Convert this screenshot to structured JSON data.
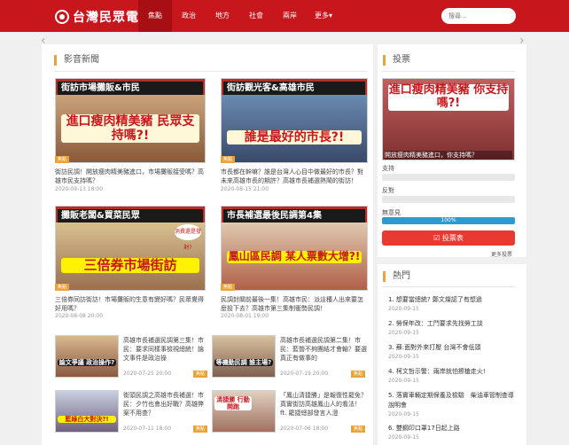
{
  "header": {
    "logo": "台灣民眾電子報",
    "nav": [
      "焦點",
      "政治",
      "地方",
      "社會",
      "兩岸",
      "更多▾"
    ],
    "search_placeholder": "搜尋..."
  },
  "video": {
    "title": "影音新聞",
    "tag": "焦點",
    "cards": [
      {
        "banner": "街訪市場攤販&市民",
        "big": "進口瘦肉精美豬 民眾支持嗎?!",
        "text": "街訪民調！開放瘦肉精美豬進口，市場攤販接受嗎？高雄市民支持嗎？",
        "date": "2020-09-13 18:00"
      },
      {
        "banner": "街訪觀光客&高雄市民",
        "big": "誰是最好的市長?!",
        "text": "市長都在幹嘛？誰是台灣人心目中做最好的市長？對未來高雄市長的期許？高雄市長補選熱鬧的街訪！",
        "date": "2020-08-15 21:00"
      },
      {
        "banner": "攤販老闆&買菜民眾",
        "big": "三倍券市場街訪",
        "sticker": "消費還是發財?",
        "text": "三倍券同訪街訪！市場攤販的生意有變好嗎？民眾覺得好用嗎？",
        "date": "2020-08-08 20:00"
      },
      {
        "banner": "市長補選最後民調第4集",
        "big": "鳳山區民調 某人票數大增?!",
        "text": "民調封關前最後一集！高雄市民：派這種人出來要怎麼投下去？高雄市第三集制衝勢民調！",
        "date": "2020-08-01 19:00"
      }
    ],
    "small_cards": [
      {
        "thumb": "論文爭議 政治操作?",
        "text": "高雄市長補選民調第三集！市民：要求同樣事檢視總統！論文事件是政治操",
        "date": "2020-07-25 20:00"
      },
      {
        "thumb": "等機動民調 誰主場?",
        "text": "高雄市長補選民調第二集！市民：藍營不夠團結才會輸？要選真正有做事的",
        "date": "2020-07-19 20:00"
      },
      {
        "thumb": "藍綠白大對決?!",
        "text": "街頭民調之高雄市長補選！市民：夕竹也會出好戰？高雄弊案不用查？",
        "date": "2020-07-11 18:00"
      },
      {
        "thumb": "清捷勝 行動開跑",
        "text": "「鳳山清捷勝」是報復性罷免？真實街訪高雄鳳山人的看法！ft. 罷捷總部發言人澄",
        "date": "2020-07-06 18:00"
      }
    ]
  },
  "poll": {
    "title": "投票",
    "image_text": "進口瘦肉精美豬 你支持嗎?!",
    "caption": "開放瘦肉精美豬進口，你支持嗎？",
    "options": [
      {
        "label": "支持",
        "percent": 0,
        "text": ""
      },
      {
        "label": "反對",
        "percent": 0,
        "text": ""
      },
      {
        "label": "無意見",
        "percent": 100,
        "text": "100%"
      }
    ],
    "vote_label": "☑ 投票表",
    "more_label": "更多投票"
  },
  "hot": {
    "title": "熱門",
    "items": [
      {
        "text": "1. 想要當總統? 鄭文燦認了有想過",
        "date": "2020-09-15"
      },
      {
        "text": "2. 勞保年改：工鬥要求先找勞工談",
        "date": "2020-09-15"
      },
      {
        "text": "3. 蘇:面對外來打壓 台灣不會低頭",
        "date": "2020-09-15"
      },
      {
        "text": "4. 柯文哲示警：兩岸就怕擦槍走火!",
        "date": "2020-09-15"
      },
      {
        "text": "5. 落實車輛定期保養及檢驗　柴油車管制查導說明會",
        "date": "2020-09-15"
      },
      {
        "text": "6. 雙鋼印口罩17日起上路",
        "date": "2020-09-15"
      }
    ]
  },
  "colors": {
    "brand": "#c8161d",
    "accent": "#e8a33d",
    "poll_bar": "#2a9bd3"
  }
}
